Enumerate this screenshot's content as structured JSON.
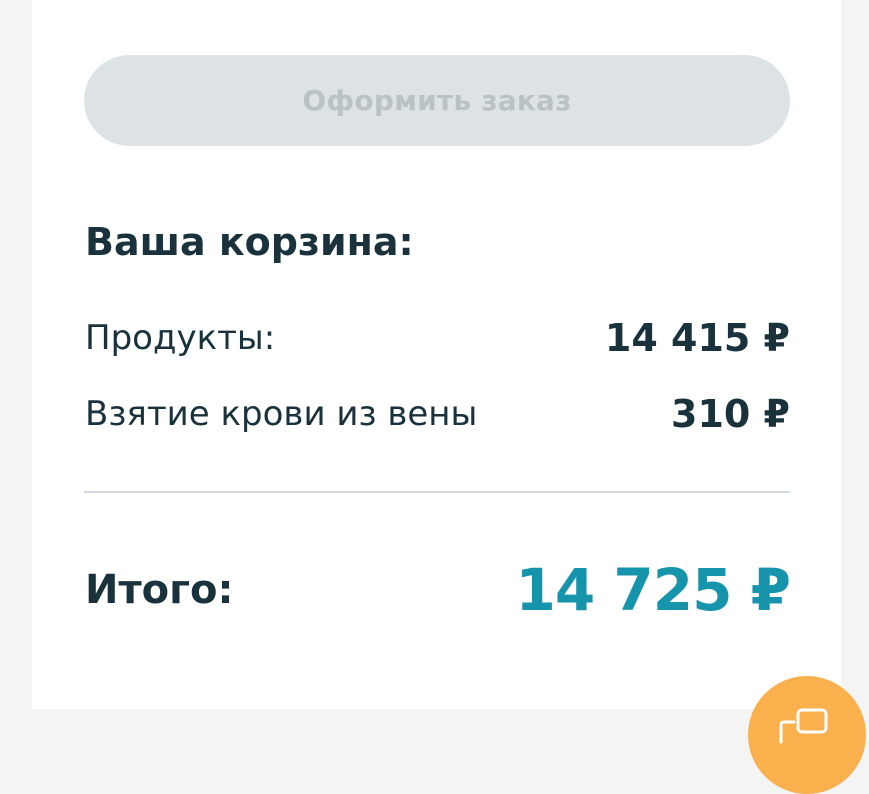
{
  "checkout": {
    "button_label": "Оформить заказ",
    "enabled": false
  },
  "cart": {
    "title": "Ваша корзина:",
    "items": [
      {
        "label": "Продукты:",
        "value": "14 415 ₽"
      },
      {
        "label": "Взятие крови из вены",
        "value": "310 ₽"
      }
    ],
    "total_label": "Итого:",
    "total_value": "14 725 ₽"
  },
  "chat": {
    "icon": "chat-icon"
  },
  "colors": {
    "accent": "#1594ab",
    "text": "#19323b",
    "button_disabled_bg": "#dde3e5",
    "button_disabled_text": "#b9c3c6",
    "chat_button": "#f9b04d"
  }
}
